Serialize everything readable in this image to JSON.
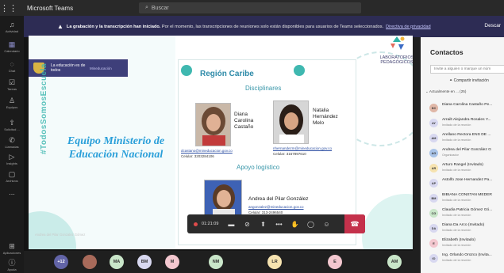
{
  "titlebar": {
    "app_name": "Microsoft Teams",
    "search_placeholder": "Buscar"
  },
  "rail": [
    {
      "label": "Actividad",
      "icon": "bell-icon"
    },
    {
      "label": "Calendario",
      "icon": "calendar-icon"
    },
    {
      "label": "Chat",
      "icon": "chat-icon"
    },
    {
      "label": "Tareas",
      "icon": "tasks-icon"
    },
    {
      "label": "Equipos",
      "icon": "teams-icon"
    },
    {
      "label": "Solicitud ...",
      "icon": "request-icon"
    },
    {
      "label": "Llamadas",
      "icon": "phone-icon"
    },
    {
      "label": "Insights",
      "icon": "insights-icon"
    },
    {
      "label": "Archivos",
      "icon": "files-icon"
    },
    {
      "label": "...",
      "icon": "more-icon"
    },
    {
      "label": "Aplicaciones",
      "icon": "apps-icon"
    },
    {
      "label": "Ayuda",
      "icon": "help-icon"
    }
  ],
  "banner": {
    "bold_text": "La grabación y la transcripción han iniciado.",
    "text": "Por el momento, las transcripciones de reuniones solo están disponibles para usuarios de Teams seleccionados.",
    "link": "Directiva de privacidad",
    "dismiss": "Descar"
  },
  "slide": {
    "logo_text": "La educación es de todos",
    "logo_ministry": "Mineducación",
    "labs": "LABORATORIOS PEDAGÓGICOS",
    "title": "Equipo Ministerio de Educación Nacional",
    "vertical_hashtag": "#TodosSomosEscuela",
    "region": "Región Caribe",
    "disciplinares": "Disciplinares",
    "apoyo": "Apoyo logístico",
    "people": [
      {
        "name": "Diana Carolina Castaño",
        "email": "dcastano@mineducacion.gov.co",
        "phone": "Celular: 3203284106"
      },
      {
        "name": "Natalia Hernández Melo",
        "email": "nhernandezm@mineducacion.gov.co",
        "phone": "Celular: 3167897610"
      },
      {
        "name": "Andrea del Pilar González",
        "email": "angonzalez@mineducacion.gov.co",
        "phone": "Celular: 313-2496540"
      }
    ],
    "shared_by": "Andrea del Pilar Gonzalez Gómez"
  },
  "controls": {
    "timer": "01:21:09"
  },
  "gallery": [
    {
      "initials": "+12",
      "color": "#6264a7"
    },
    {
      "initials": "",
      "color": "#a86a5a",
      "photo": true
    },
    {
      "initials": "MA",
      "color": "#c9e6c9"
    },
    {
      "initials": "BM",
      "color": "#d8d8f0"
    },
    {
      "initials": "M",
      "color": "#f3c7cf"
    },
    {
      "initials": "NM",
      "color": "#c9e6c9"
    },
    {
      "initials": "LR",
      "color": "#f6e3b0"
    },
    {
      "initials": "E",
      "color": "#f3c7cf"
    },
    {
      "initials": "AM",
      "color": "#c9e6c9"
    }
  ],
  "panel": {
    "title": "Contactos",
    "invite_placeholder": "Invite a alguien o marque un núm",
    "share_label": "Compartir invitación",
    "section": "Actualmente en ... (25)",
    "participants": [
      {
        "initials": "DC",
        "name": "Diana Carolina Castaño Pe...",
        "status": "",
        "color": "#e0b7a7"
      },
      {
        "initials": "AY",
        "name": "Arrailt Alejandra Rosales Y...",
        "status": "Invitado de la reunión",
        "color": "#d8d8f0"
      },
      {
        "initials": "AM",
        "name": "Arellano Rectora ENS DE ...",
        "status": "Invitado de la reunión",
        "color": "#d8d8f0"
      },
      {
        "initials": "AG",
        "name": "Andrea del Pilar González G",
        "status": "Organizador",
        "color": "#a9c4e8"
      },
      {
        "initials": "AR",
        "name": "Arturo Rangel (Invitado)",
        "status": "Invitado de la reunión",
        "color": "#f6e3b0"
      },
      {
        "initials": "AP",
        "name": "Astolfo Jose Hernandez Pa...",
        "status": "",
        "color": "#d8d8f0"
      },
      {
        "initials": "BM",
        "name": "BIBIANA CONSTAN MEDER",
        "status": "Invitado de la reunión",
        "color": "#d8d8f0"
      },
      {
        "initials": "CG",
        "name": "Claudia Patricia Gómez Gó...",
        "status": "Invitado de la reunión",
        "color": "#c9e6c9"
      },
      {
        "initials": "DA",
        "name": "Diana Da Arco (Invitado)",
        "status": "Invitado de la reunión",
        "color": "#d8d8f0"
      },
      {
        "initials": "E",
        "name": "Elizabeth (Invitado)",
        "status": "Invitado de la reunión",
        "color": "#f3c7cf"
      },
      {
        "initials": "IO",
        "name": "Ing. Orlando Orozco (Invita...",
        "status": "Invitado de la reunión",
        "color": "#d8d8f0"
      }
    ]
  }
}
